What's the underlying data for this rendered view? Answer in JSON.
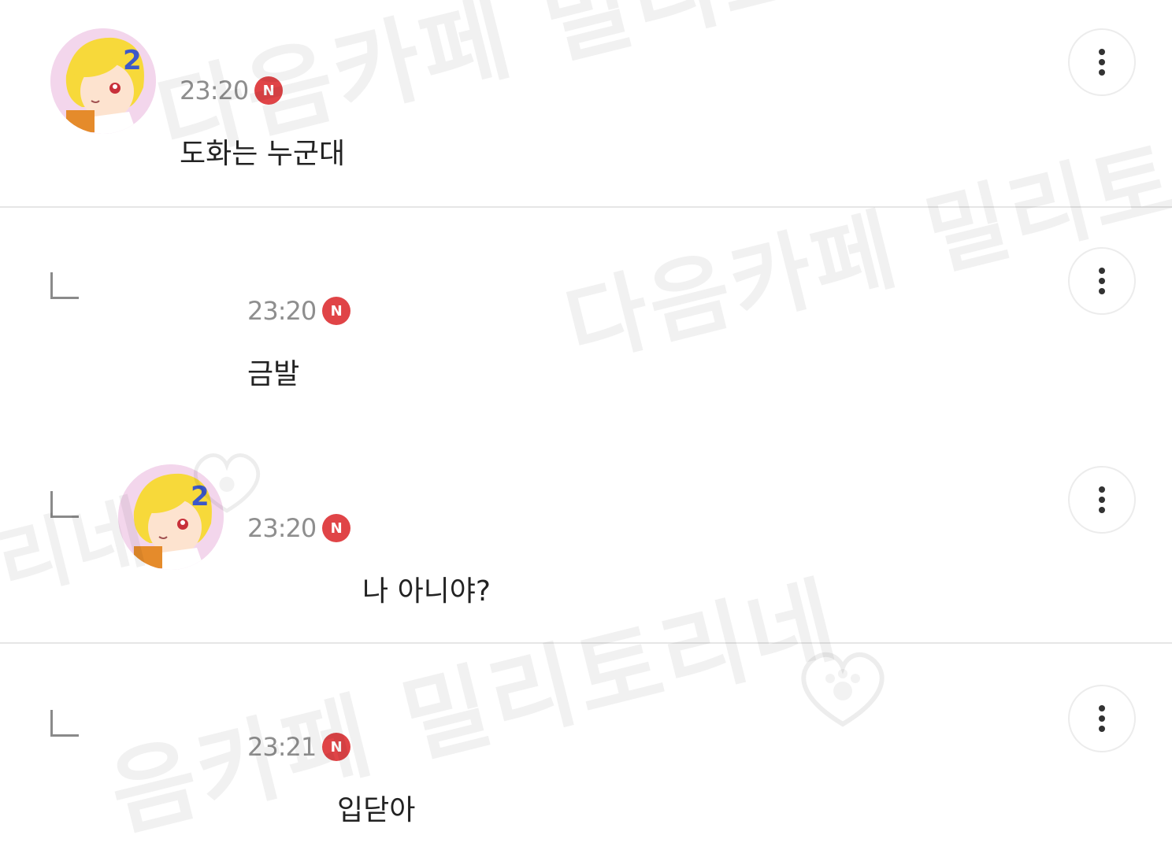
{
  "watermark": {
    "text_a": "다음카페 밀리토리네",
    "text_b": "다음카페 밀리토리",
    "text_c": "음카페 밀리토리네",
    "text_d": "리네"
  },
  "comments": [
    {
      "time": "23:20",
      "badge": "N",
      "text": "도화는 누군대",
      "has_avatar": true,
      "is_reply": false
    },
    {
      "time": "23:20",
      "badge": "N",
      "text": "금발",
      "has_avatar": false,
      "is_reply": true
    },
    {
      "time": "23:20",
      "badge": "N",
      "text": "나 아니야?",
      "has_avatar": true,
      "is_reply": true
    },
    {
      "time": "23:21",
      "badge": "N",
      "text": "입닫아",
      "has_avatar": false,
      "is_reply": true
    }
  ],
  "colors": {
    "badge": "#e04447",
    "time": "#8e8e8e",
    "divider": "#e6e6e6"
  },
  "icons": {
    "more": "more-vertical-icon",
    "reply": "reply-corner-icon",
    "new": "new-badge-icon"
  }
}
